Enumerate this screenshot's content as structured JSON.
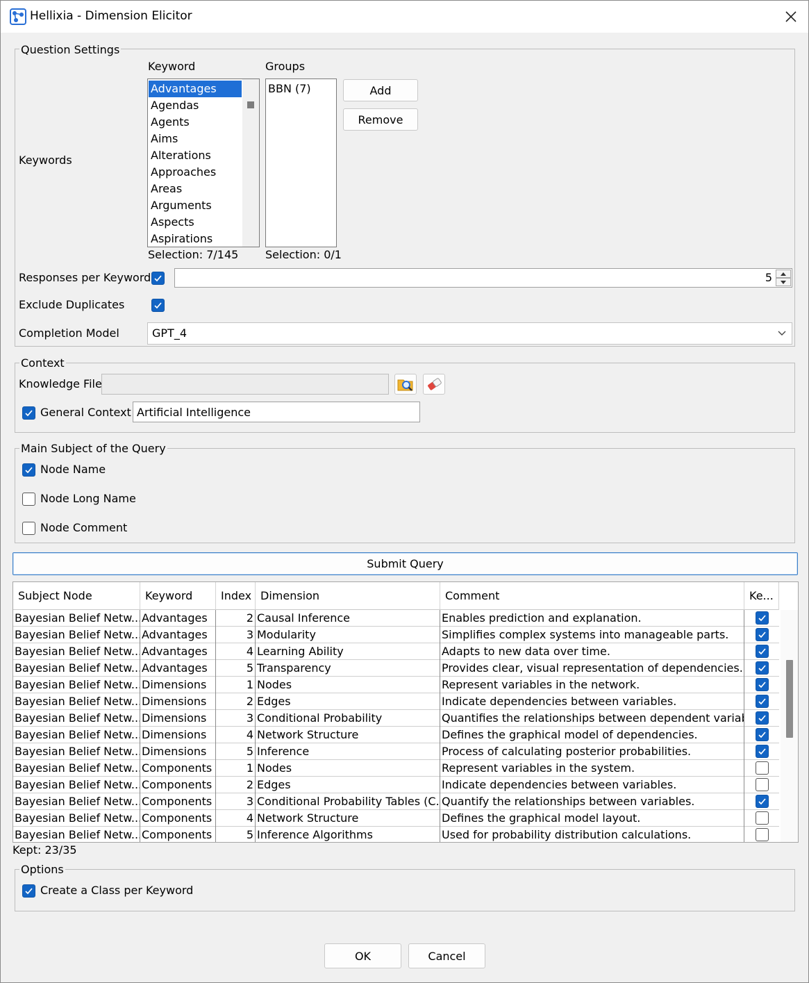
{
  "window": {
    "title": "Hellixia - Dimension Elicitor"
  },
  "question_settings": {
    "legend": "Question Settings",
    "keywords_label": "Keywords",
    "keyword_header": "Keyword",
    "groups_header": "Groups",
    "keyword_list": [
      "Advantages",
      "Agendas",
      "Agents",
      "Aims",
      "Alterations",
      "Approaches",
      "Areas",
      "Arguments",
      "Aspects",
      "Aspirations"
    ],
    "keyword_selection": "Selection: 7/145",
    "groups_list": [
      "BBN (7)"
    ],
    "groups_selection": "Selection: 0/1",
    "add_label": "Add",
    "remove_label": "Remove",
    "responses_label": "Responses per Keyword",
    "responses_value": "5",
    "exclude_label": "Exclude Duplicates",
    "completion_label": "Completion Model",
    "completion_value": "GPT_4"
  },
  "context": {
    "legend": "Context",
    "knowledge_label": "Knowledge File",
    "general_context_label": "General Context",
    "general_context_value": "Artificial Intelligence"
  },
  "main_subject": {
    "legend": "Main Subject of the Query",
    "node_name": "Node Name",
    "node_long_name": "Node Long Name",
    "node_comment": "Node Comment"
  },
  "submit_label": "Submit Query",
  "table": {
    "headers": [
      "Subject Node",
      "Keyword",
      "Index",
      "Dimension",
      "Comment",
      "Ke..."
    ],
    "rows": [
      {
        "subject": "Bayesian Belief Netw...",
        "keyword": "Advantages",
        "index": "2",
        "dimension": "Causal Inference",
        "comment": "Enables prediction and explanation.",
        "kept": true
      },
      {
        "subject": "Bayesian Belief Netw...",
        "keyword": "Advantages",
        "index": "3",
        "dimension": "Modularity",
        "comment": "Simplifies complex systems into manageable parts.",
        "kept": true
      },
      {
        "subject": "Bayesian Belief Netw...",
        "keyword": "Advantages",
        "index": "4",
        "dimension": "Learning Ability",
        "comment": "Adapts to new data over time.",
        "kept": true
      },
      {
        "subject": "Bayesian Belief Netw...",
        "keyword": "Advantages",
        "index": "5",
        "dimension": "Transparency",
        "comment": "Provides clear, visual representation of dependencies.",
        "kept": true
      },
      {
        "subject": "Bayesian Belief Netw...",
        "keyword": "Dimensions",
        "index": "1",
        "dimension": "Nodes",
        "comment": "Represent variables in the network.",
        "kept": true
      },
      {
        "subject": "Bayesian Belief Netw...",
        "keyword": "Dimensions",
        "index": "2",
        "dimension": "Edges",
        "comment": "Indicate dependencies between variables.",
        "kept": true
      },
      {
        "subject": "Bayesian Belief Netw...",
        "keyword": "Dimensions",
        "index": "3",
        "dimension": "Conditional Probability",
        "comment": "Quantifies the relationships between dependent variabl...",
        "kept": true
      },
      {
        "subject": "Bayesian Belief Netw...",
        "keyword": "Dimensions",
        "index": "4",
        "dimension": "Network Structure",
        "comment": "Defines the graphical model of dependencies.",
        "kept": true
      },
      {
        "subject": "Bayesian Belief Netw...",
        "keyword": "Dimensions",
        "index": "5",
        "dimension": "Inference",
        "comment": "Process of calculating posterior probabilities.",
        "kept": true
      },
      {
        "subject": "Bayesian Belief Netw...",
        "keyword": "Components",
        "index": "1",
        "dimension": "Nodes",
        "comment": "Represent variables in the system.",
        "kept": false
      },
      {
        "subject": "Bayesian Belief Netw...",
        "keyword": "Components",
        "index": "2",
        "dimension": "Edges",
        "comment": "Indicate dependencies between variables.",
        "kept": false
      },
      {
        "subject": "Bayesian Belief Netw...",
        "keyword": "Components",
        "index": "3",
        "dimension": "Conditional Probability Tables (C...",
        "comment": "Quantify the relationships between variables.",
        "kept": true
      },
      {
        "subject": "Bayesian Belief Netw...",
        "keyword": "Components",
        "index": "4",
        "dimension": "Network Structure",
        "comment": "Defines the graphical model layout.",
        "kept": false
      },
      {
        "subject": "Bayesian Belief Netw...",
        "keyword": "Components",
        "index": "5",
        "dimension": "Inference Algorithms",
        "comment": "Used for probability distribution calculations.",
        "kept": false
      }
    ]
  },
  "kept_text": "Kept: 23/35",
  "options": {
    "legend": "Options",
    "class_per_keyword": "Create a Class per Keyword"
  },
  "ok_label": "OK",
  "cancel_label": "Cancel"
}
